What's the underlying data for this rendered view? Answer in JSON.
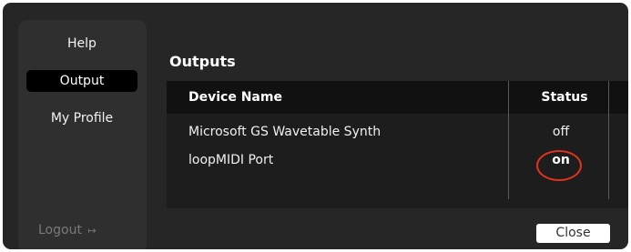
{
  "sidebar": {
    "items": [
      {
        "label": "Help",
        "selected": false
      },
      {
        "label": "Output",
        "selected": true
      },
      {
        "label": "My Profile",
        "selected": false
      }
    ],
    "logout_label": "Logout",
    "logout_icon": "↦"
  },
  "main": {
    "title": "Outputs",
    "table": {
      "columns": [
        "Device Name",
        "Status"
      ],
      "rows": [
        {
          "name": "Microsoft GS Wavetable Synth",
          "status": "off"
        },
        {
          "name": "loopMIDI Port",
          "status": "on"
        }
      ]
    },
    "close_label": "Close"
  },
  "colors": {
    "window_bg": "#262626",
    "sidebar_bg": "#2f2f2f",
    "selected_item_bg": "#000000",
    "table_header_bg": "#111111",
    "table_body_bg": "#1d1d1d",
    "highlight_ring": "#e0321e"
  }
}
